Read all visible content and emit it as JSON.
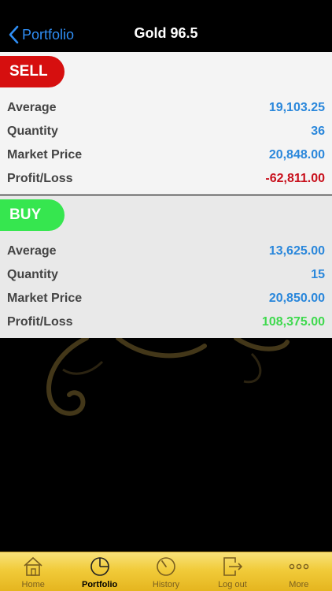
{
  "nav": {
    "back_label": "Portfolio",
    "title": "Gold 96.5"
  },
  "sell": {
    "label": "SELL",
    "rows": [
      {
        "label": "Average",
        "value": "19,103.25"
      },
      {
        "label": "Quantity",
        "value": "36"
      },
      {
        "label": "Market Price",
        "value": "20,848.00"
      },
      {
        "label": "Profit/Loss",
        "value": "-62,811.00"
      }
    ]
  },
  "buy": {
    "label": "BUY",
    "rows": [
      {
        "label": "Average",
        "value": "13,625.00"
      },
      {
        "label": "Quantity",
        "value": "15"
      },
      {
        "label": "Market Price",
        "value": "20,850.00"
      },
      {
        "label": "Profit/Loss",
        "value": "108,375.00"
      }
    ]
  },
  "tabs": [
    {
      "label": "Home",
      "icon": "home-icon"
    },
    {
      "label": "Portfolio",
      "icon": "pie-chart-icon",
      "active": true
    },
    {
      "label": "History",
      "icon": "clock-icon"
    },
    {
      "label": "Log out",
      "icon": "logout-icon"
    },
    {
      "label": "More",
      "icon": "more-dots-icon"
    }
  ],
  "colors": {
    "sell": "#d60f0f",
    "buy": "#36e64f",
    "value_blue": "#2a87db",
    "loss_red": "#c8101c",
    "profit_green": "#3fd94e",
    "tabbar_gold": "#f1cb3a"
  }
}
